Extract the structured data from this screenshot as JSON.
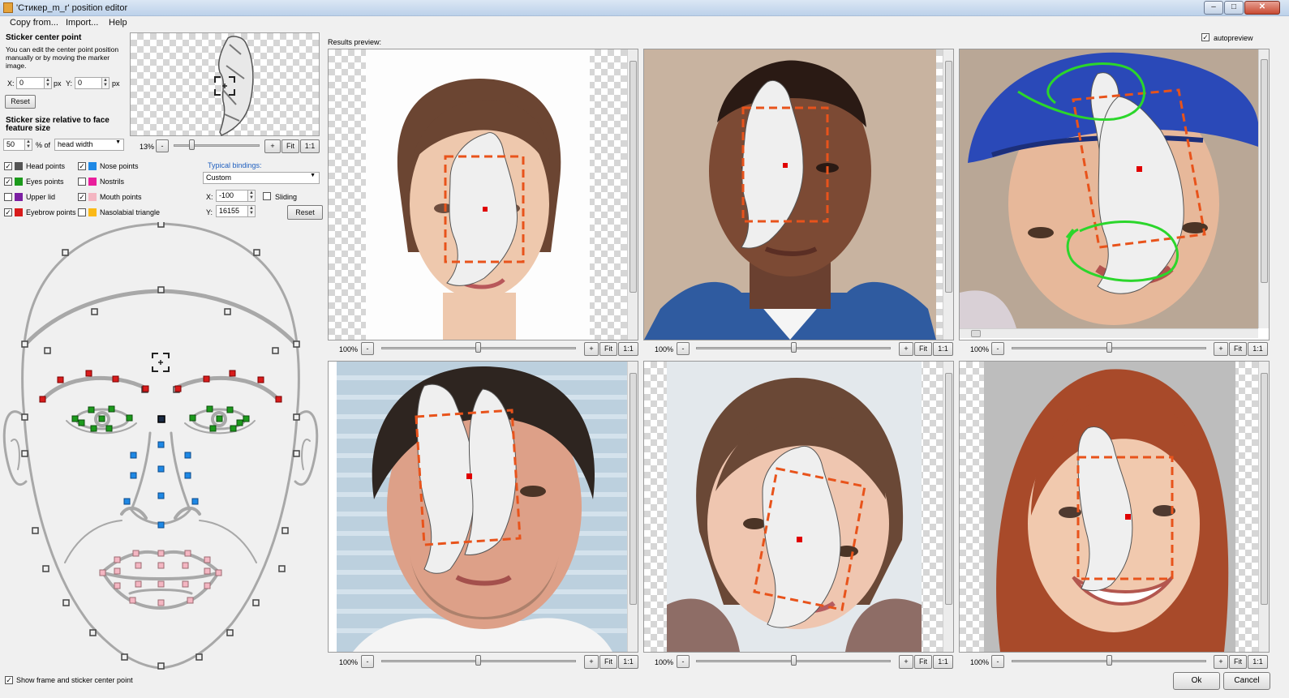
{
  "window": {
    "title": "'Стикер_m_r' position editor",
    "controls": {
      "minimize": "–",
      "maximize": "□",
      "close": "✕"
    }
  },
  "menu": {
    "items": [
      "Copy from...",
      "Import...",
      "Help"
    ]
  },
  "center_point": {
    "heading": "Sticker center point",
    "description": "You can edit the center point position manually or by moving the marker image.",
    "x_label": "X:",
    "x_value": "0",
    "y_label": "Y:",
    "y_value": "0",
    "unit": "px",
    "reset_label": "Reset"
  },
  "sticker_thumb": {
    "zoom": "13%",
    "plus": "+",
    "fit": "Fit",
    "one_to_one": "1:1"
  },
  "size": {
    "heading": "Sticker size relative to face feature size",
    "value": "50",
    "unit": "% of",
    "basis": "head width"
  },
  "point_groups": [
    {
      "label": "Head points",
      "checked": true,
      "color": "#555555"
    },
    {
      "label": "Eyes points",
      "checked": true,
      "color": "#1c9a1c"
    },
    {
      "label": "Upper lid",
      "checked": false,
      "color": "#7b1fa2"
    },
    {
      "label": "Eyebrow points",
      "checked": true,
      "color": "#d81b1b"
    },
    {
      "label": "Nose points",
      "checked": true,
      "color": "#1e88e5"
    },
    {
      "label": "Nostrils",
      "checked": false,
      "color": "#e91e9c"
    },
    {
      "label": "Mouth points",
      "checked": true,
      "color": "#f4b6c2"
    },
    {
      "label": "Nasolabial triangle",
      "checked": false,
      "color": "#fbb917"
    }
  ],
  "bindings": {
    "label": "Typical bindings:",
    "value": "Custom",
    "x_label": "X:",
    "x_value": "-100",
    "y_label": "Y:",
    "y_value": "16155",
    "sliding_label": "Sliding",
    "reset_label": "Reset"
  },
  "show_frame": {
    "label": "Show frame and sticker center point",
    "checked": true
  },
  "preview": {
    "label": "Results preview:",
    "autopreview_label": "autopreview",
    "autopreview_checked": true,
    "cells": [
      {
        "zoom": "100%",
        "minus": "-",
        "plus": "+",
        "fit": "Fit",
        "one_to_one": "1:1"
      },
      {
        "zoom": "100%",
        "minus": "-",
        "plus": "+",
        "fit": "Fit",
        "one_to_one": "1:1"
      },
      {
        "zoom": "100%",
        "minus": "-",
        "plus": "+",
        "fit": "Fit",
        "one_to_one": "1:1"
      },
      {
        "zoom": "100%",
        "minus": "-",
        "plus": "+",
        "fit": "Fit",
        "one_to_one": "1:1"
      },
      {
        "zoom": "100%",
        "minus": "-",
        "plus": "+",
        "fit": "Fit",
        "one_to_one": "1:1"
      },
      {
        "zoom": "100%",
        "minus": "-",
        "plus": "+",
        "fit": "Fit",
        "one_to_one": "1:1"
      }
    ]
  },
  "footer": {
    "ok_label": "Ok",
    "cancel_label": "Cancel"
  },
  "colors": {
    "frame": "#e8531b",
    "center_dot": "#e00000",
    "annotation": "#2bd62b",
    "face_line": "#a8a8a8",
    "link": "#1f5fbf"
  }
}
